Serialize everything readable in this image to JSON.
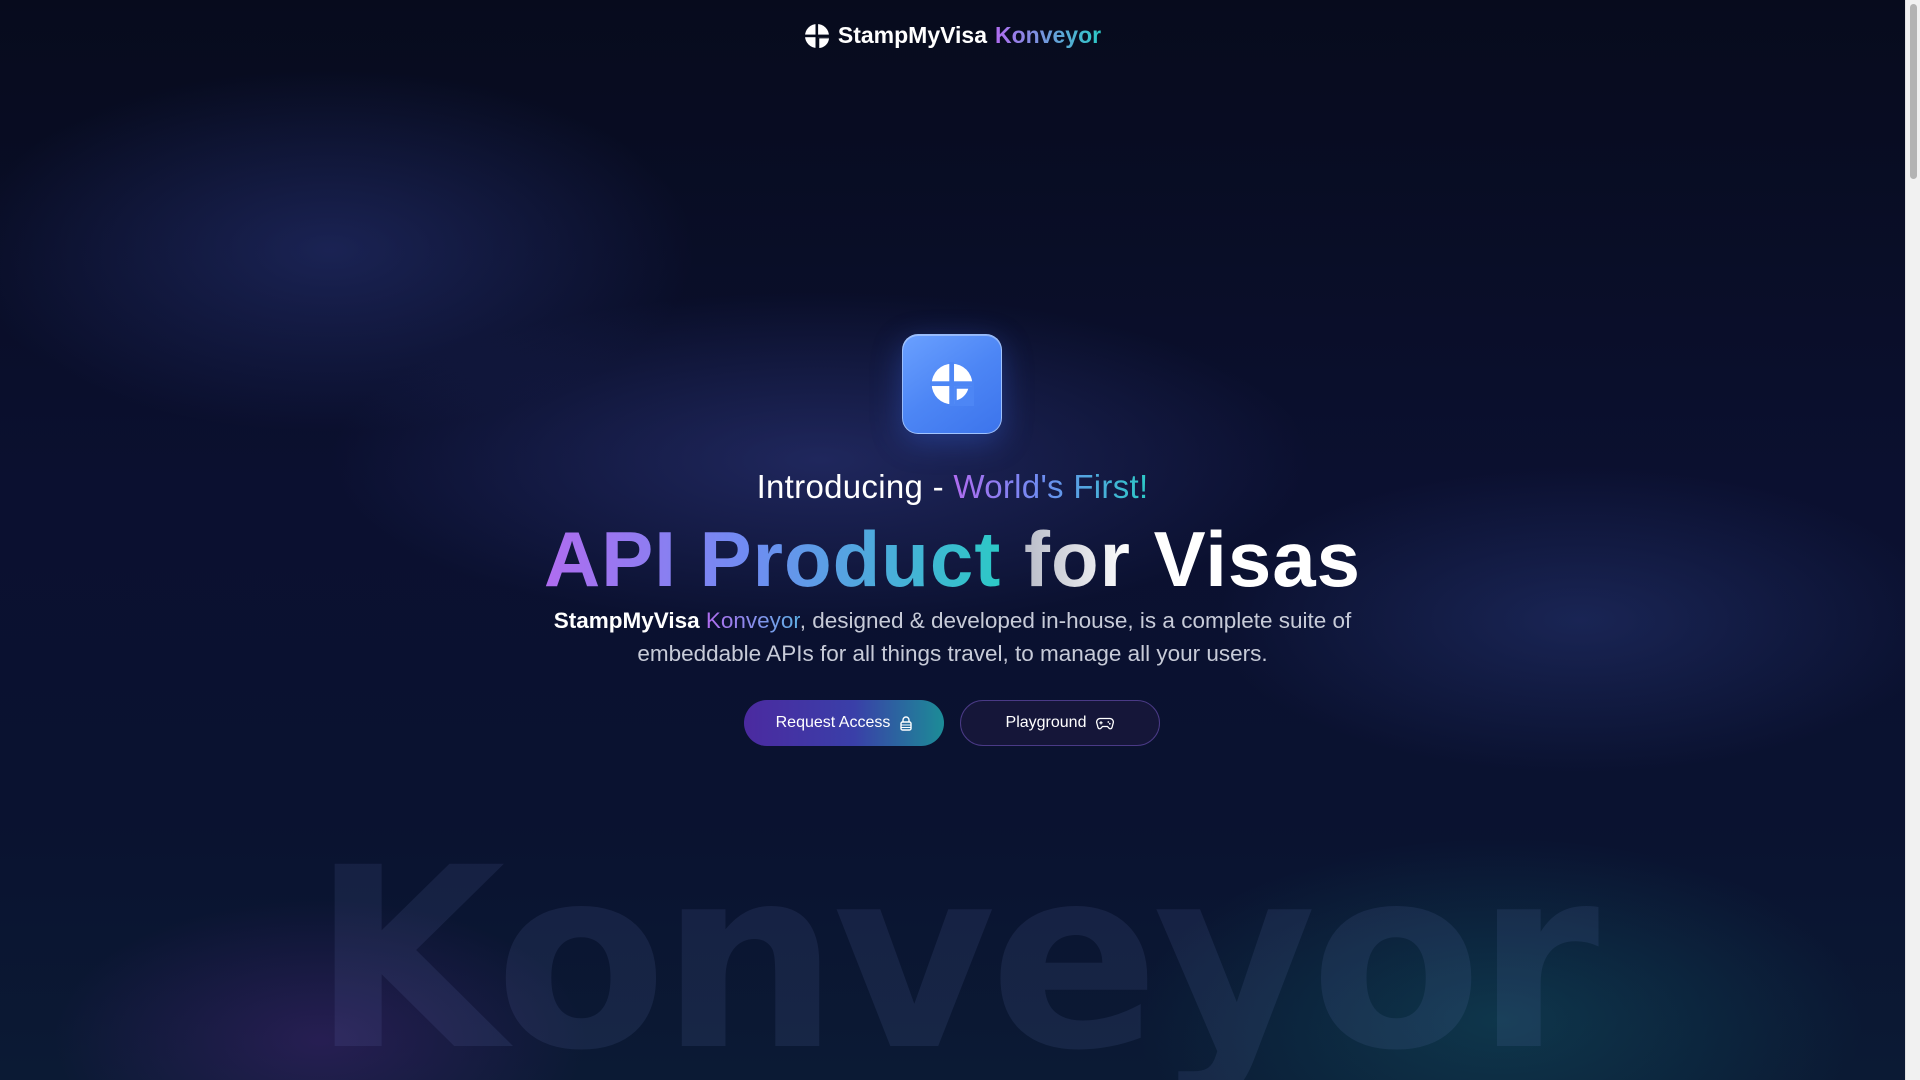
{
  "nav": {
    "brand": "StampMyVisa",
    "brand_accent": "Konveyor"
  },
  "hero": {
    "intro_prefix": "Introducing - ",
    "intro_highlight": "World's First!",
    "headline_gradient": "API Product",
    "headline_for": "for",
    "headline_end": "Visas",
    "desc_brand": "StampMyVisa",
    "desc_accent": "Konveyor",
    "desc_line1_rest": ", designed & developed in-house, is a complete suite of",
    "desc_line2": "embeddable APIs for all things travel, to manage all your users."
  },
  "buttons": {
    "request_access": "Request Access",
    "playground": "Playground"
  },
  "background": {
    "watermark": "Konveyor"
  },
  "icons": {
    "logo": "stampmyvisa-logo-icon",
    "request_access": "lock-icon",
    "playground": "gamepad-icon"
  },
  "colors": {
    "page_bg": "#060b1c",
    "accent_purple": "#b06cf0",
    "accent_teal": "#2cc9c6",
    "app_icon_blue": "#4d86f5"
  }
}
